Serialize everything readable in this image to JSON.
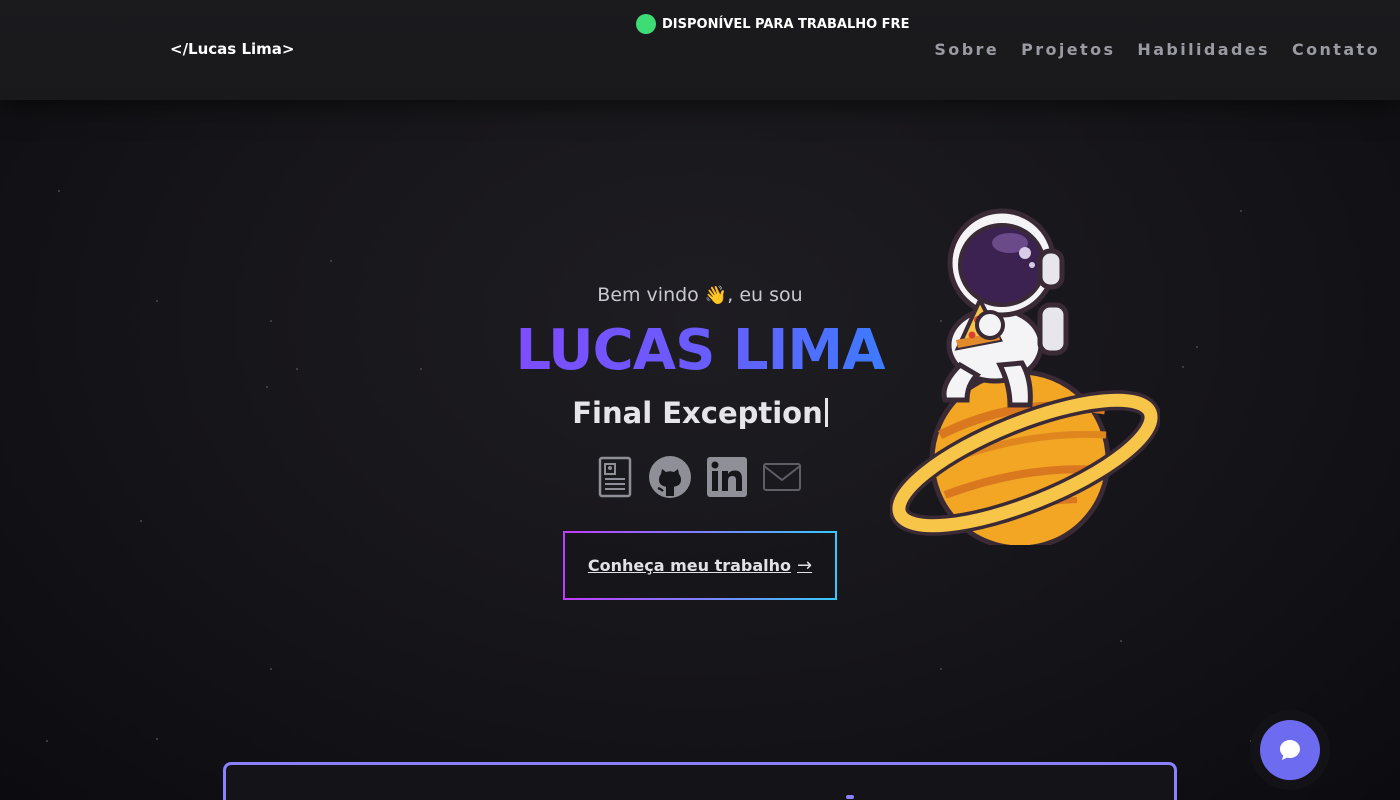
{
  "header": {
    "logo": "</Lucas Lima>",
    "status_text": "DISPONÍVEL PARA TRABALHO FRE",
    "status_color": "#3ddc75",
    "nav": [
      {
        "label": "Sobre"
      },
      {
        "label": "Projetos"
      },
      {
        "label": "Habilidades"
      },
      {
        "label": "Contato"
      }
    ]
  },
  "hero": {
    "greeting_before": "Bem vindo",
    "wave_emoji": "👋",
    "greeting_after": ", eu sou",
    "name": "LUCAS LIMA",
    "role": "Final Exception",
    "socials": [
      {
        "icon": "resume-icon"
      },
      {
        "icon": "github-icon"
      },
      {
        "icon": "linkedin-icon"
      },
      {
        "icon": "mail-icon"
      }
    ],
    "cta_label": "Conheça meu trabalho",
    "cta_arrow": "→"
  },
  "colors": {
    "accent_purple": "#7c4dff",
    "accent_blue": "#3d7bff",
    "chat_button": "#6d6cf0"
  },
  "chat": {
    "icon": "chat-icon"
  }
}
